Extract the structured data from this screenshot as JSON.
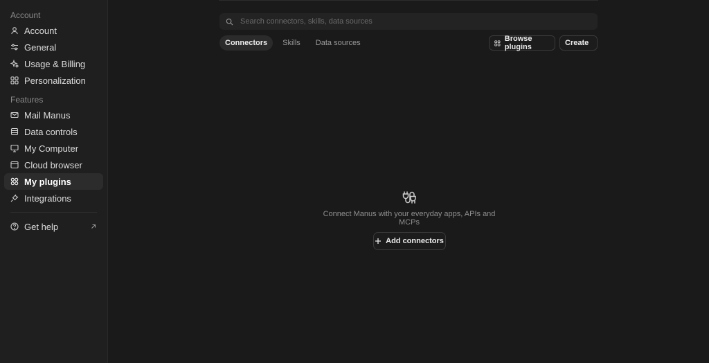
{
  "sidebar": {
    "account_section": "Account",
    "account_items": [
      {
        "label": "Account",
        "icon": "user-icon"
      },
      {
        "label": "General",
        "icon": "sliders-icon"
      },
      {
        "label": "Usage & Billing",
        "icon": "sparkle-icon"
      },
      {
        "label": "Personalization",
        "icon": "grid-icon"
      }
    ],
    "features_section": "Features",
    "feature_items": [
      {
        "label": "Mail Manus",
        "icon": "mail-icon"
      },
      {
        "label": "Data controls",
        "icon": "database-icon"
      },
      {
        "label": "My Computer",
        "icon": "monitor-icon"
      },
      {
        "label": "Cloud browser",
        "icon": "browser-icon"
      },
      {
        "label": "My plugins",
        "icon": "apps-icon",
        "active": true
      },
      {
        "label": "Integrations",
        "icon": "plug-icon"
      }
    ],
    "help": {
      "label": "Get help",
      "icon": "help-icon"
    }
  },
  "main": {
    "search": {
      "placeholder": "Search connectors, skills, data sources"
    },
    "tabs": [
      {
        "label": "Connectors",
        "active": true
      },
      {
        "label": "Skills"
      },
      {
        "label": "Data sources"
      }
    ],
    "browse_label": "Browse plugins",
    "create_label": "Create",
    "empty": {
      "message": "Connect Manus with your everyday apps, APIs and MCPs",
      "button_label": "Add connectors",
      "icon": "connector-icon"
    }
  },
  "colors": {
    "background": "#1a1a1a",
    "sidebar": "#1f1f1f",
    "active": "#2c2c2c",
    "text": "#d6d6d6",
    "muted": "#8a8a8a"
  }
}
